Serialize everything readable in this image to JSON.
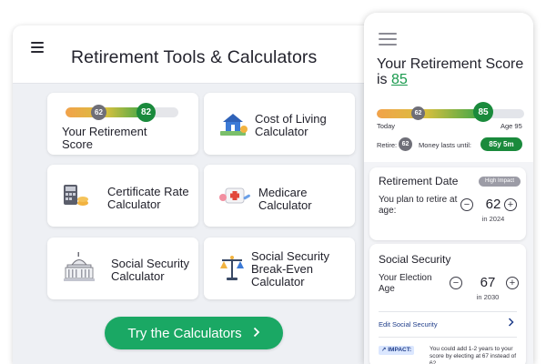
{
  "desktop": {
    "title": "Retirement Tools & Calculators",
    "tiles": {
      "score": {
        "label": "Your Retirement Score",
        "low": "62",
        "high": "82",
        "level_fraction": 0.72
      },
      "cost_of_living": {
        "label": "Cost of Living Calculator",
        "icon": "house-cash-icon"
      },
      "certificate": {
        "label": "Certificate Rate Calculator",
        "icon": "calculator-coins-icon"
      },
      "medicare": {
        "label": "Medicare Calculator",
        "icon": "medical-kit-icon"
      },
      "social_security": {
        "label": "Social Security Calculator",
        "icon": "capitol-building-icon"
      },
      "break_even": {
        "label": "Social Security Break-Even Calculator",
        "icon": "balance-scale-icon"
      }
    },
    "cta": {
      "label": "Try the Calculators",
      "icon": "chevron-right-icon"
    }
  },
  "phone": {
    "score_prefix": "Your Retirement Score is",
    "score_value": "85",
    "bar": {
      "low": "62",
      "high": "85",
      "level_fraction": 0.72
    },
    "scale_start": "Today",
    "scale_end": "Age 95",
    "retire_label": "Retire:",
    "retire_value": "62",
    "money_label": "Money lasts until:",
    "money_value": "85y 5m",
    "retirement_date": {
      "title": "Retirement Date",
      "badge": "High Impact",
      "prompt": "You plan to retire at age:",
      "age": "62",
      "year": "in 2024",
      "minus": "−",
      "plus": "+"
    },
    "social_security": {
      "title": "Social Security",
      "prompt": "Your Election Age",
      "age": "67",
      "year": "in 2030",
      "minus": "−",
      "plus": "+",
      "edit_label": "Edit Social Security",
      "impact_label": "↗ IMPACT:",
      "impact_text": "You could add 1-2 years to your score by electing at 67 instead of 62."
    }
  },
  "colors": {
    "accent_green": "#1aa864",
    "score_green": "#1a9a4e",
    "badge_grey": "#6f6f78",
    "link_blue": "#1f3d8a"
  }
}
